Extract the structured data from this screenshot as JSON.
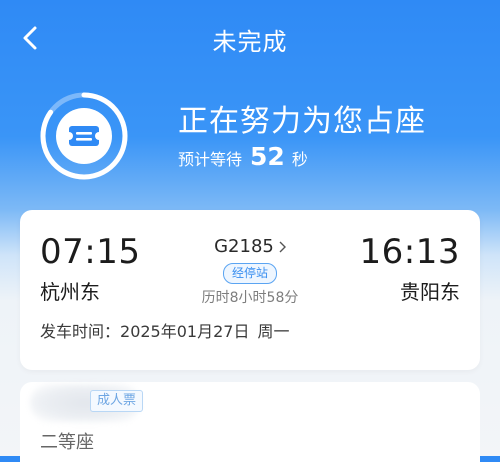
{
  "nav": {
    "title": "未完成",
    "back_icon": "chevron-left-icon"
  },
  "status": {
    "title": "正在努力为您占座",
    "wait_prefix": "预计等待",
    "wait_seconds": "52",
    "wait_unit": "秒",
    "icon": "ticket-icon",
    "colors": {
      "ring": "#ffffff",
      "icon_bg": "#ffffff",
      "icon_fg": "#2f8af5"
    }
  },
  "trip": {
    "departure_time": "07:15",
    "departure_station": "杭州东",
    "arrival_time": "16:13",
    "arrival_station": "贵阳东",
    "train_number": "G2185",
    "stops_badge": "经停站",
    "duration": "历时8小时58分",
    "departure_label": "发车时间：",
    "departure_date": "2025年01月27日",
    "departure_weekday": "周一"
  },
  "passenger": {
    "ticket_type": "成人票",
    "seat_class": "二等座"
  },
  "colors": {
    "primary": "#2f8af5",
    "badge": "#3a8ff0"
  }
}
